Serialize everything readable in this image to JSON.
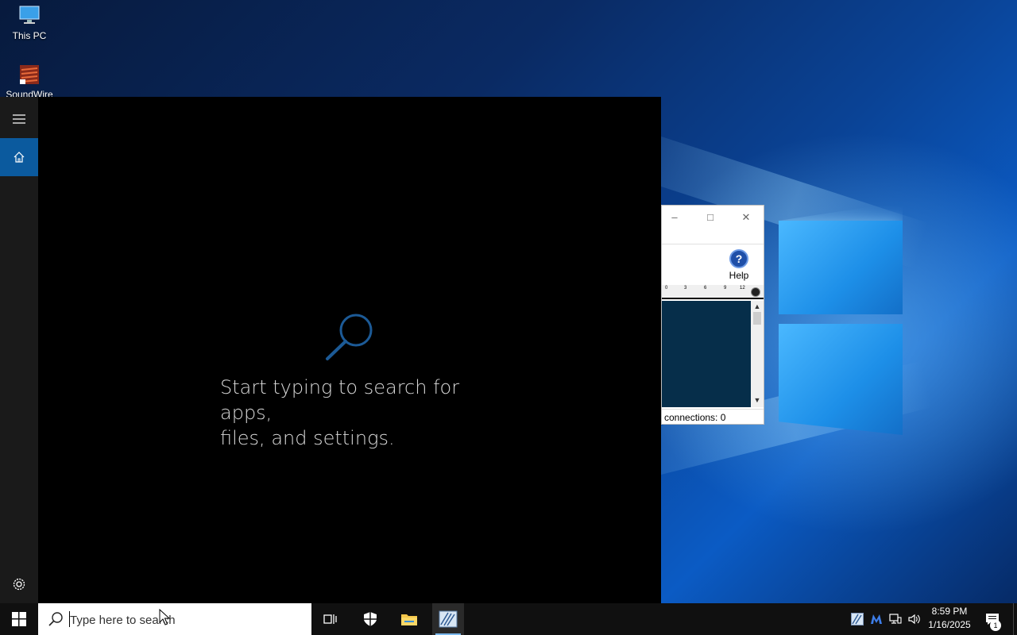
{
  "desktop": {
    "icons": [
      {
        "label": "This PC",
        "icon": "computer-icon"
      },
      {
        "label": "SoundWire",
        "icon": "soundwire-app-icon"
      }
    ]
  },
  "background_window": {
    "help_label": "Help",
    "status_text": "connections: 0",
    "ruler_ticks": [
      "0",
      "3",
      "6",
      "9",
      "12"
    ],
    "controls": {
      "minimize": "–",
      "maximize": "□",
      "close": "✕"
    }
  },
  "start_panel": {
    "search_hint_line1": "Start typing to search for apps,",
    "search_hint_line2": "files, and settings.",
    "rail": [
      {
        "name": "menu-icon"
      },
      {
        "name": "home-icon",
        "active": true
      },
      {
        "name": "settings-icon"
      }
    ]
  },
  "taskbar": {
    "search_placeholder": "Type here to search",
    "pinned": [
      {
        "name": "task-view-icon"
      },
      {
        "name": "windows-security-icon"
      },
      {
        "name": "file-explorer-icon"
      },
      {
        "name": "soundwire-taskbar-icon",
        "active": true
      }
    ],
    "tray_icons": [
      "soundwire-tray-icon",
      "malwarebytes-icon",
      "network-icon",
      "volume-icon"
    ],
    "time": "8:59 PM",
    "date": "1/16/2025",
    "notification_count": "1"
  },
  "colors": {
    "accent": "#0b5a9e",
    "taskbar": "#101010",
    "start_panel": "#000000",
    "rail": "#1a1a1a"
  }
}
